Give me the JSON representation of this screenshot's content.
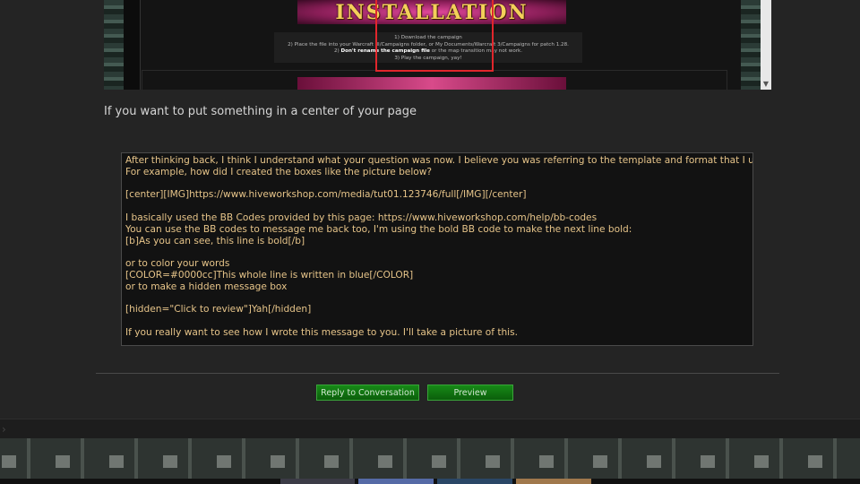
{
  "embedded_image": {
    "banner_title": "INSTALLATION",
    "steps": [
      "1) Download the campaign",
      "2) Place the file into your Warcraft III/Campaigns folder, or My Documents/Warcraft 3/Campaigns for patch 1.28.",
      "3) Play the campaign, yay!"
    ],
    "step2_prefix": "2) ",
    "step2_bold": "Don't rename the campaign file",
    "step2_suffix": " or the map transition may not work.",
    "highlight_color": "#e1262c"
  },
  "caption": "If you want to put something in a center of your page",
  "editor": {
    "lines": [
      "After thinking back, I think I understand what your question was now. I believe you was referring to the template and format that I used.",
      "For example, how did I created the boxes like the picture below?",
      "",
      "[center][IMG]https://www.hiveworkshop.com/media/tut01.123746/full[/IMG][/center]",
      "",
      "I basically used the BB Codes provided by this page: https://www.hiveworkshop.com/help/bb-codes",
      "You can use the BB codes to message me back too, I'm using the bold BB code to make the next line bold:",
      "[b]As you can see, this line is bold[/b]",
      "",
      "or to color your words",
      "[COLOR=#0000cc]This whole line is written in blue[/COLOR]",
      "or to make a hidden message box",
      "",
      "[hidden=\"Click to review\"]Yah[/hidden]",
      "",
      "If you really want to see how I wrote this message to you. I'll take a picture of this."
    ],
    "text_color": "#e6c489"
  },
  "buttons": {
    "reply_label": "Reply to Conversation",
    "preview_label": "Preview"
  },
  "colors": {
    "page_bg": "#242424",
    "button_green": "#178a17"
  }
}
